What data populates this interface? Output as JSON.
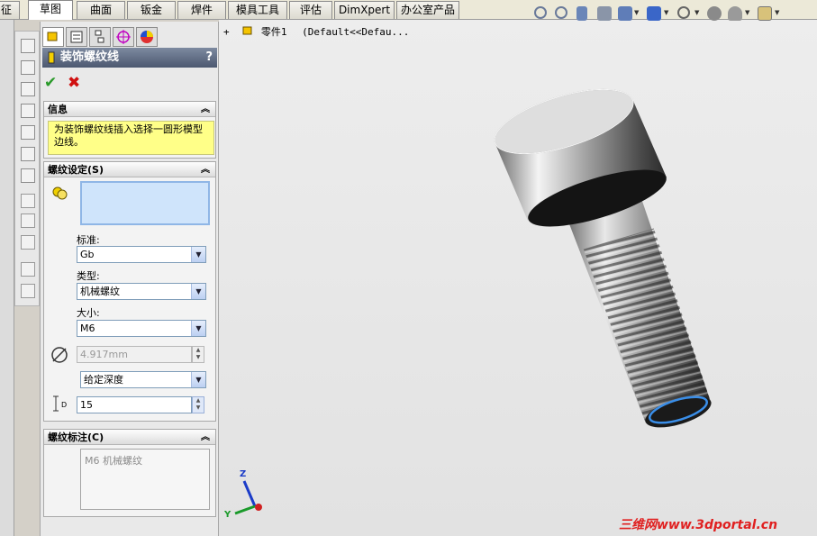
{
  "top_tabs": [
    "征",
    "草图",
    "曲面",
    "钣金",
    "焊件",
    "模具工具",
    "评估",
    "DimXpert",
    "办公室产品"
  ],
  "tree": {
    "expand": "+",
    "part_name": "零件1",
    "config": "(Default<<Defau..."
  },
  "property_manager": {
    "title": "装饰螺纹线",
    "help": "?",
    "ok_symbol": "✔",
    "cancel_symbol": "✖",
    "info": {
      "header": "信息",
      "message": "为装饰螺纹线插入选择一圆形模型边线。"
    },
    "thread_settings": {
      "header": "螺纹设定(S)",
      "standard_label": "标准:",
      "standard_value": "Gb",
      "type_label": "类型:",
      "type_value": "机械螺纹",
      "size_label": "大小:",
      "size_value": "M6",
      "diameter_value": "4.917mm",
      "end_condition_value": "给定深度",
      "depth_value": "15"
    },
    "thread_callout": {
      "header": "螺纹标注(C)",
      "text": "M6 机械螺纹"
    }
  },
  "triad": {
    "z": "Z",
    "y": "Y"
  },
  "watermark": "三维网www.3dportal.cn",
  "colors": {
    "title_bar": "#5a667c",
    "info_bg": "#ffff88",
    "selection_bg": "#cfe4fb",
    "highlight_edge": "#3a8ee8"
  }
}
